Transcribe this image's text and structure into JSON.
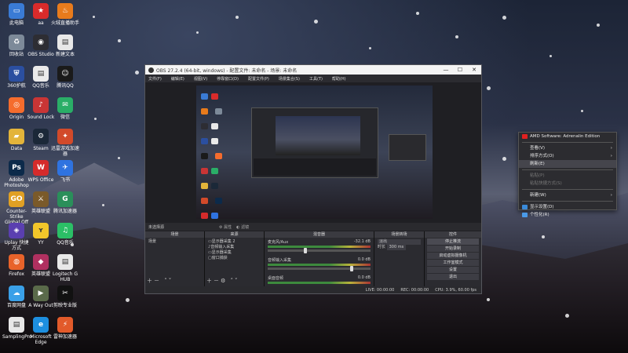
{
  "desktop_icons": [
    {
      "label": "此电脑",
      "icon": "computer-icon",
      "color": "#3a7bd5",
      "glyph": "▭"
    },
    {
      "label": "aa",
      "icon": "red-star-icon",
      "color": "#d92b2b",
      "glyph": "★"
    },
    {
      "label": "火绒直播助手",
      "icon": "fire-icon",
      "color": "#e87b1c",
      "glyph": "♨"
    },
    {
      "label": "回收站",
      "icon": "recycle-bin-icon",
      "color": "#7d8a99",
      "glyph": "♻"
    },
    {
      "label": "OBS Studio",
      "icon": "obs-icon",
      "color": "#2d2d33",
      "glyph": "◉"
    },
    {
      "label": "新建文本",
      "icon": "document-icon",
      "color": "#e8e8e8",
      "glyph": "▤"
    },
    {
      "label": "360护航",
      "icon": "shield-app-icon",
      "color": "#2b4fa0",
      "glyph": "⛨"
    },
    {
      "label": "QQ音乐",
      "icon": "document-icon",
      "color": "#eaeaea",
      "glyph": "▤"
    },
    {
      "label": "腾讯QQ",
      "icon": "qq-penguin-icon",
      "color": "#1a1a1a",
      "glyph": "☺"
    },
    {
      "label": "Origin",
      "icon": "origin-icon",
      "color": "#f56c2d",
      "glyph": "◎"
    },
    {
      "label": "Sound Lock",
      "icon": "speaker-icon",
      "color": "#c93535",
      "glyph": "♪"
    },
    {
      "label": "微信",
      "icon": "wechat-icon",
      "color": "#2aae67",
      "glyph": "✉"
    },
    {
      "label": "Data",
      "icon": "folder-icon",
      "color": "#e3b43a",
      "glyph": "▰"
    },
    {
      "label": "Steam",
      "icon": "steam-icon",
      "color": "#1b2838",
      "glyph": "⚙"
    },
    {
      "label": "迅雷游戏加速器",
      "icon": "game-booster-icon",
      "color": "#d24a2a",
      "glyph": "✦"
    },
    {
      "label": "Adobe Photoshop",
      "icon": "photoshop-icon",
      "color": "#0c2a4a",
      "glyph": "Ps"
    },
    {
      "label": "WPS Office",
      "icon": "wps-icon",
      "color": "#d52b2b",
      "glyph": "W"
    },
    {
      "label": "飞书",
      "icon": "feishu-icon",
      "color": "#2f73e0",
      "glyph": "✈"
    },
    {
      "label": "Counter-Strike Global Off",
      "icon": "csgo-icon",
      "color": "#e0a024",
      "glyph": "GO"
    },
    {
      "label": "英雄联盟",
      "icon": "game-icon",
      "color": "#7a5a2a",
      "glyph": "⚔"
    },
    {
      "label": "腾讯加速器",
      "icon": "accelerator-icon",
      "color": "#2a8f5a",
      "glyph": "G"
    },
    {
      "label": "Uplay 快捷方式",
      "icon": "uplay-icon",
      "color": "#5a3fb0",
      "glyph": "◈"
    },
    {
      "label": "YY",
      "icon": "yy-icon",
      "color": "#f2c62a",
      "glyph": "ʏ"
    },
    {
      "label": "QQ音乐",
      "icon": "qq-music-icon",
      "color": "#2bbf66",
      "glyph": "♫"
    },
    {
      "label": "Firefox",
      "icon": "firefox-icon",
      "color": "#e8632a",
      "glyph": "◍"
    },
    {
      "label": "英雄联盟",
      "icon": "game-icon",
      "color": "#b03060",
      "glyph": "◆"
    },
    {
      "label": "Logitech G HUB",
      "icon": "document-icon",
      "color": "#e8e8e8",
      "glyph": "▤"
    },
    {
      "label": "百度网盘",
      "icon": "cloud-icon",
      "color": "#3aa0e8",
      "glyph": "☁"
    },
    {
      "label": "A Way Out",
      "icon": "game-icon",
      "color": "#5a6a4a",
      "glyph": "▶"
    },
    {
      "label": "剪映专业版",
      "icon": "capcut-icon",
      "color": "#111111",
      "glyph": "✂"
    },
    {
      "label": "SamplingPro",
      "icon": "sampling-icon",
      "color": "#e8e8e8",
      "glyph": "▤"
    },
    {
      "label": "Microsoft Edge",
      "icon": "edge-icon",
      "color": "#1d8fe0",
      "glyph": "e"
    },
    {
      "label": "雷神加速器",
      "icon": "thunder-icon",
      "color": "#e25a2a",
      "glyph": "⚡"
    }
  ],
  "obs": {
    "title": "OBS 27.2.4 (64-bit, windows) - 配置文件: 未命名 - 场景: 未命名",
    "menu": [
      "文件(F)",
      "编辑(E)",
      "视图(V)",
      "停靠窗口(D)",
      "配置文件(P)",
      "场景集合(S)",
      "工具(T)",
      "帮助(H)"
    ],
    "scene_bar": {
      "label": "未选择源",
      "props": "属性",
      "filters": "滤镜"
    },
    "docks": {
      "scenes": {
        "title": "场景",
        "items": [
          "场景"
        ]
      },
      "sources": {
        "title": "来源",
        "items": [
          "显示器采集 2",
          "音频输入采集",
          "显示器采集",
          "窗口捕获"
        ]
      },
      "mixer": {
        "title": "混音器",
        "tracks": [
          {
            "name": "麦克风/Aux",
            "db": "-32.1 dB",
            "level": 0.35
          },
          {
            "name": "音频输入采集",
            "db": "0.0 dB",
            "level": 0.8
          },
          {
            "name": "桌面音频",
            "db": "0.0 dB",
            "level": 0.6
          }
        ]
      },
      "transitions": {
        "title": "场景转场",
        "type": "淡出",
        "duration_label": "时长",
        "duration": "300 ms"
      },
      "controls": {
        "title": "控件",
        "buttons": [
          "停止推流",
          "开始录制",
          "启动虚拟摄像机",
          "工作室模式",
          "设置",
          "退出"
        ]
      }
    },
    "status": {
      "live": "LIVE: 00:00:00",
      "rec": "REC: 00:00:00",
      "cpu": "CPU: 3.9%, 60.00 fps"
    }
  },
  "context_menu": {
    "items": [
      {
        "label": "AMD Software: Adrenalin Edition",
        "icon": "amd-icon",
        "color": "#e02020",
        "disabled": false,
        "arrow": false
      },
      {
        "sep": true
      },
      {
        "label": "查看(V)",
        "disabled": false,
        "arrow": true
      },
      {
        "label": "排序方式(O)",
        "disabled": false,
        "arrow": true
      },
      {
        "label": "刷新(E)",
        "disabled": false,
        "arrow": false,
        "hover": true
      },
      {
        "sep": true
      },
      {
        "label": "粘贴(P)",
        "disabled": true,
        "arrow": false
      },
      {
        "label": "粘贴快捷方式(S)",
        "disabled": true,
        "arrow": false
      },
      {
        "sep": true
      },
      {
        "label": "新建(W)",
        "disabled": false,
        "arrow": true
      },
      {
        "sep": true
      },
      {
        "label": "显示设置(D)",
        "icon": "display-settings-icon",
        "color": "#3a8ad8",
        "disabled": false,
        "arrow": false
      },
      {
        "label": "个性化(R)",
        "icon": "personalize-icon",
        "color": "#4a9ae8",
        "disabled": false,
        "arrow": false
      }
    ]
  }
}
